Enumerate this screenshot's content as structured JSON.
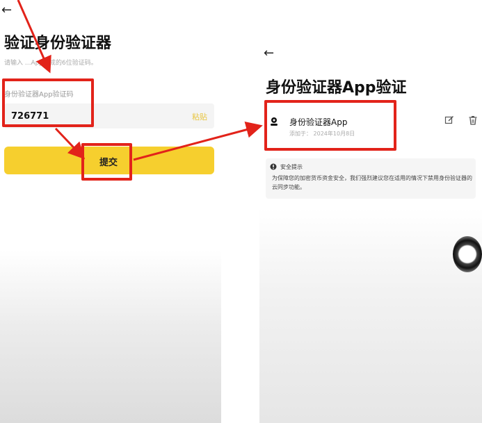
{
  "left": {
    "back_icon": "←",
    "title": "验证身份验证器",
    "subtitle": "请输入 ...App生成的6位验证码。",
    "field_label": "身份验证器App验证码",
    "code_value": "726771",
    "paste_label": "粘贴",
    "submit_label": "提交"
  },
  "right": {
    "back_icon": "←",
    "title": "身份验证器App验证",
    "authenticator": {
      "name": "身份验证器App",
      "added_date": "添加于： 2024年10月8日"
    },
    "security": {
      "title": "安全提示",
      "text": "为保障您的加密货币资金安全，我们强烈建议您在适用的情况下禁用身份验证器的云同步功能。"
    }
  },
  "colors": {
    "accent_yellow": "#f6cf2e",
    "annotation_red": "#e2231a"
  },
  "icons": [
    "back-arrow-icon",
    "authenticator-icon",
    "edit-icon",
    "delete-icon",
    "warning-icon"
  ]
}
